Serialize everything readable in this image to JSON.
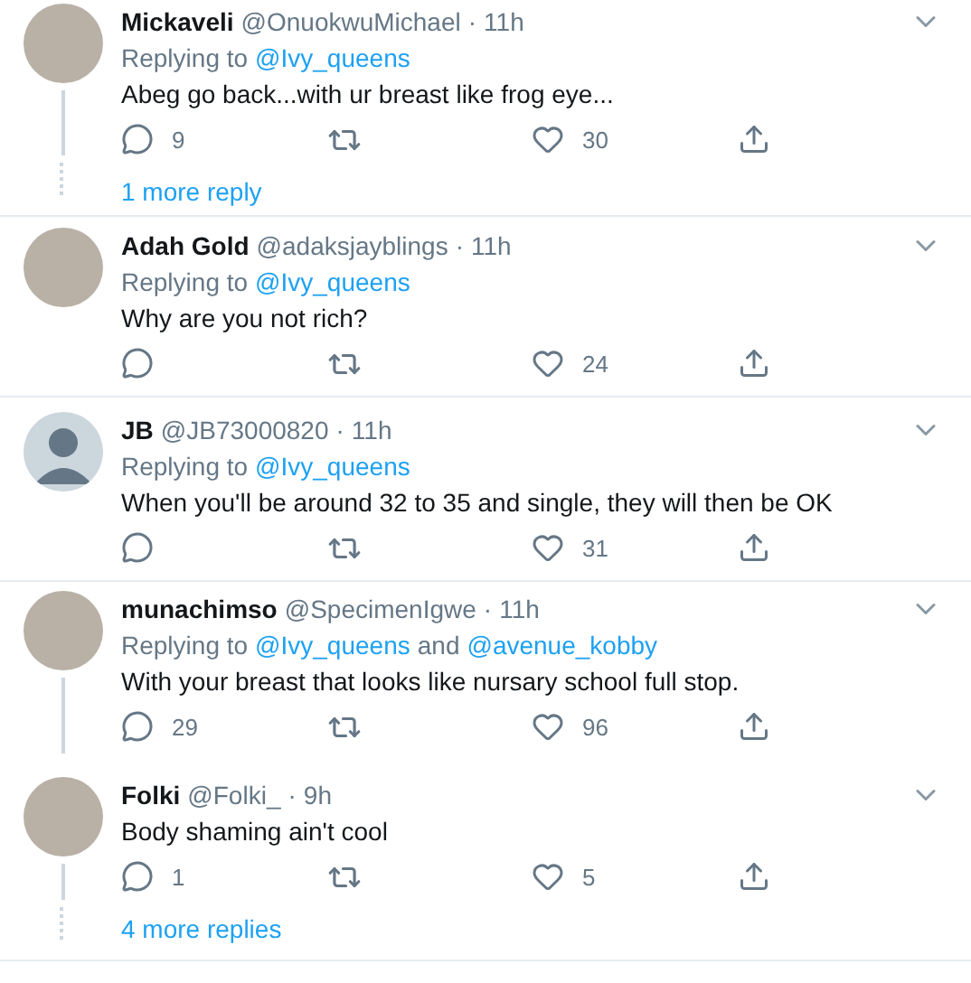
{
  "tweets": [
    {
      "name": "Mickaveli",
      "handle": "@OnuokwuMichael",
      "sep": "·",
      "time": "11h",
      "default_avatar": false,
      "replying": {
        "prefix": "Replying to",
        "parts": [
          {
            "kind": "mention",
            "text": "@Ivy_queens"
          }
        ]
      },
      "text": "Abeg go back...with ur breast like frog eye...",
      "replies": "9",
      "likes": "30",
      "thread": true,
      "more": "1 more reply"
    },
    {
      "name": "Adah Gold",
      "handle": "@adaksjayblings",
      "sep": "·",
      "time": "11h",
      "default_avatar": false,
      "replying": {
        "prefix": "Replying to",
        "parts": [
          {
            "kind": "mention",
            "text": "@Ivy_queens"
          }
        ]
      },
      "text": "Why are you not rich?",
      "likes": "24",
      "thread": false
    },
    {
      "name": "JB",
      "handle": "@JB73000820",
      "sep": "·",
      "time": "11h",
      "default_avatar": true,
      "replying": {
        "prefix": "Replying to",
        "parts": [
          {
            "kind": "mention",
            "text": "@Ivy_queens"
          }
        ]
      },
      "text": "When you'll be around 32 to 35 and single, they will then be OK",
      "likes": "31",
      "thread": false
    },
    {
      "name": "munachimso",
      "handle": "@SpecimenIgwe",
      "sep": "·",
      "time": "11h",
      "default_avatar": false,
      "replying": {
        "prefix": "Replying to",
        "parts": [
          {
            "kind": "mention",
            "text": "@Ivy_queens"
          },
          {
            "kind": "word",
            "text": "and"
          },
          {
            "kind": "mention",
            "text": "@avenue_kobby"
          }
        ]
      },
      "text": "With your breast that looks like nursary school full stop.",
      "replies": "29",
      "likes": "96",
      "thread": true
    },
    {
      "name": "Folki",
      "handle": "@Folki_",
      "sep": "·",
      "time": "9h",
      "default_avatar": false,
      "text": "Body shaming ain't cool",
      "replies": "1",
      "likes": "5",
      "thread": true,
      "more": "4 more replies"
    }
  ]
}
